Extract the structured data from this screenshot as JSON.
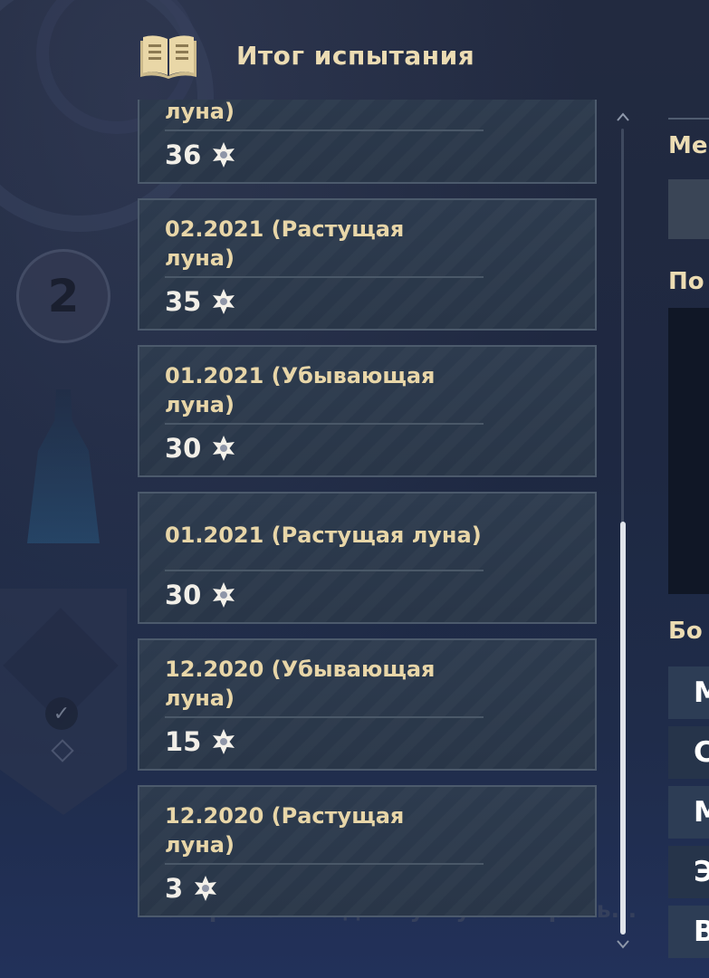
{
  "header": {
    "title": "Итог испытания",
    "icon": "open-book-icon"
  },
  "records": [
    {
      "title": "луна)",
      "score": "36"
    },
    {
      "title": "02.2021 (Растущая луна)",
      "score": "35"
    },
    {
      "title": "01.2021 (Убывающая луна)",
      "score": "30"
    },
    {
      "title": "01.2021 (Растущая луна)",
      "score": "30"
    },
    {
      "title": "12.2020 (Убывающая луна)",
      "score": "15"
    },
    {
      "title": "12.2020 (Растущая луна)",
      "score": "3"
    }
  ],
  "background": {
    "floor_number": "2",
    "faded_text": "Открылся вход в Лунную Спираль..."
  },
  "right_panel": {
    "label_1": "Ме",
    "label_2": "По",
    "label_3": "Бо",
    "rows": [
      "М",
      "С",
      "М",
      "Э",
      "В"
    ]
  },
  "colors": {
    "title_gold": "#ecdcb3",
    "card_border": "#4c5a6c",
    "card_bg": "#2b384a",
    "score_white": "#f2efe8"
  }
}
